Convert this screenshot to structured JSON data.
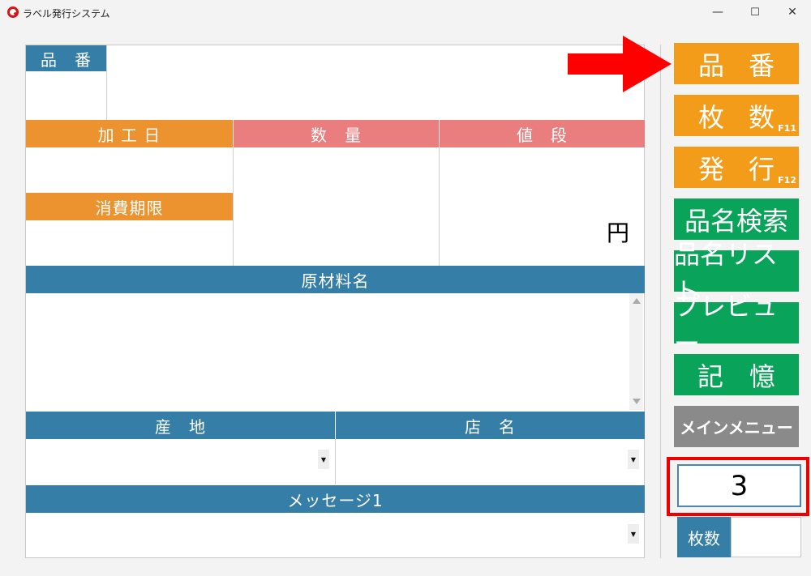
{
  "window": {
    "title": "ラベル発行システム",
    "minimize": "—",
    "maximize": "☐",
    "close": "✕"
  },
  "form": {
    "hinban_label": "品　番",
    "kakoubi_label": "加 工 日",
    "suuryou_label": "数　量",
    "nedan_label": "値　段",
    "shouhikigen_label": "消費期限",
    "yen_unit": "円",
    "genzairyou_label": "原材料名",
    "sanchi_label": "産　地",
    "tenmei_label": "店　名",
    "message_label": "メッセージ1"
  },
  "sidebar": {
    "hinban": "品番",
    "maisuu": "枚数",
    "maisuu_fkey": "F11",
    "hakkou": "発行",
    "hakkou_fkey": "F12",
    "hinmei_kensaku": "品名検索",
    "hinmei_list": "品名リスト",
    "preview": "プレビュー",
    "kioku": "記　憶",
    "main_menu": "メインメニュー",
    "count_value": "3",
    "count_label": "枚数"
  },
  "colors": {
    "header_blue": "#357ea8",
    "header_orange": "#ec932f",
    "header_pink": "#ea7e7e",
    "button_orange": "#f39c1a",
    "button_green": "#09a35a",
    "button_gray": "#8a8a8a",
    "highlight_red": "#e00000"
  }
}
